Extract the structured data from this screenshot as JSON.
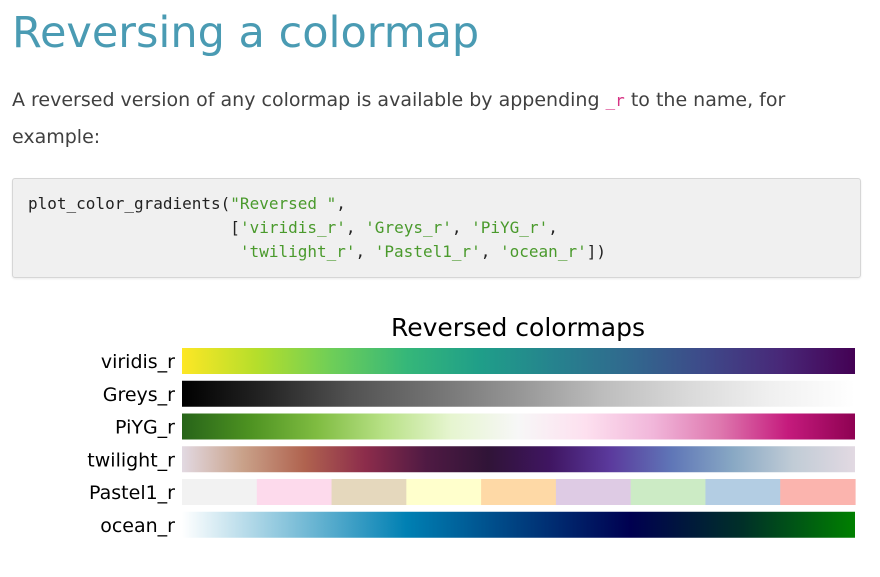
{
  "heading": "Reversing a colormap",
  "paragraph": {
    "before": "A reversed version of any colormap is available by appending ",
    "code": "_r",
    "after": " to the name, for example:"
  },
  "code": {
    "line1": {
      "fn": "plot_color_gradients(",
      "arg": "\"Reversed \"",
      "end": ","
    },
    "line2": {
      "indent": "                     ",
      "open": "[",
      "items": [
        "'viridis_r'",
        "'Greys_r'",
        "'PiYG_r'"
      ],
      "sep": ", ",
      "end": ","
    },
    "line3": {
      "indent": "                      ",
      "items": [
        "'twilight_r'",
        "'Pastel1_r'",
        "'ocean_r'"
      ],
      "sep": ", ",
      "end": "])"
    }
  },
  "chart_data": {
    "type": "heatmap",
    "title": "Reversed  colormaps",
    "rows": [
      {
        "name": "viridis_r",
        "kind": "continuous",
        "colors": [
          "#fde725",
          "#b5de2b",
          "#6ece58",
          "#35b779",
          "#1f9e89",
          "#26828e",
          "#31688e",
          "#3e4989",
          "#482878",
          "#440154"
        ]
      },
      {
        "name": "Greys_r",
        "kind": "continuous",
        "colors": [
          "#000000",
          "#252525",
          "#525252",
          "#737373",
          "#969696",
          "#bdbdbd",
          "#d9d9d9",
          "#f0f0f0",
          "#ffffff"
        ]
      },
      {
        "name": "PiYG_r",
        "kind": "continuous",
        "colors": [
          "#276419",
          "#4d9221",
          "#7fbc41",
          "#b8e186",
          "#e6f5d0",
          "#f7f7f7",
          "#fde0ef",
          "#f1b6da",
          "#de77ae",
          "#c51b7d",
          "#8e0152"
        ]
      },
      {
        "name": "twilight_r",
        "kind": "continuous",
        "colors": [
          "#e2d9e2",
          "#c9a189",
          "#b0634f",
          "#8c2c4b",
          "#4f1a43",
          "#301437",
          "#3f1561",
          "#5b3a9d",
          "#5f76b7",
          "#88a8c4",
          "#c1ccd6",
          "#e2d9e2"
        ]
      },
      {
        "name": "Pastel1_r",
        "kind": "discrete",
        "colors": [
          "#f2f2f2",
          "#fddaec",
          "#e5d8bd",
          "#ffffcc",
          "#fed9a6",
          "#decbe4",
          "#ccebc5",
          "#b3cde3",
          "#fbb4ae"
        ]
      },
      {
        "name": "ocean_r",
        "kind": "continuous",
        "colors": [
          "#ffffff",
          "#80c0d9",
          "#0080b3",
          "#004080",
          "#000050",
          "#003028",
          "#008000"
        ]
      }
    ]
  }
}
